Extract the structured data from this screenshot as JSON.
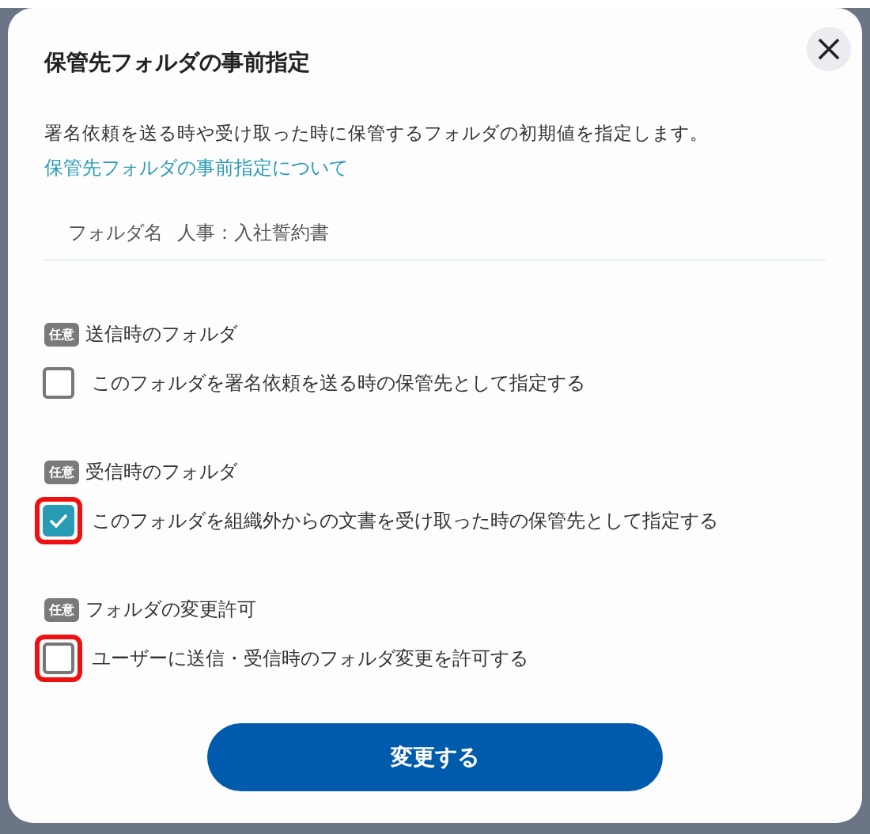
{
  "dialog": {
    "title": "保管先フォルダの事前指定",
    "description": "署名依頼を送る時や受け取った時に保管するフォルダの初期値を指定します。",
    "help_link": "保管先フォルダの事前指定について"
  },
  "folder_field": {
    "label": "フォルダ名",
    "value": "人事：入社誓約書"
  },
  "sections": [
    {
      "badge": "任意",
      "heading": "送信時のフォルダ",
      "option": "このフォルダを署名依頼を送る時の保管先として指定する",
      "checked": false,
      "highlighted": false
    },
    {
      "badge": "任意",
      "heading": "受信時のフォルダ",
      "option": "このフォルダを組織外からの文書を受け取った時の保管先として指定する",
      "checked": true,
      "highlighted": true
    },
    {
      "badge": "任意",
      "heading": "フォルダの変更許可",
      "option": "ユーザーに送信・受信時のフォルダ変更を許可する",
      "checked": false,
      "highlighted": true
    }
  ],
  "submit_button": "変更する"
}
